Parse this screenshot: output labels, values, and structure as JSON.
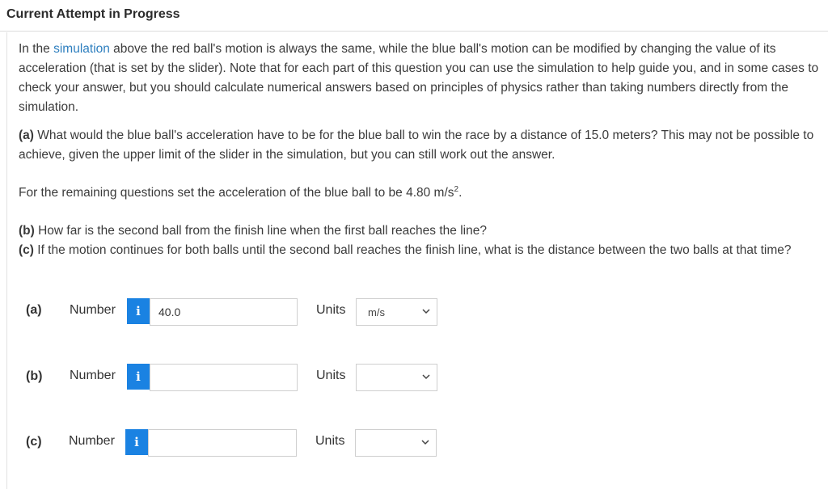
{
  "header": {
    "title": "Current Attempt in Progress"
  },
  "intro": {
    "before_link": "In the ",
    "link": "simulation",
    "after_link": " above the red ball's motion is always the same, while the blue ball's motion can be modified by changing the value of its acceleration (that is set by the slider). Note that for each part of this question you can use the simulation to help guide you, and in some cases to check your answer, but you should calculate numerical answers based on principles of physics rather than taking numbers directly from the simulation."
  },
  "part_a": {
    "tag": "(a)",
    "text": " What would the blue ball's acceleration have to be for the blue ball to win the race by a distance of 15.0 meters? This may not be possible to achieve, given the upper limit of the slider in the simulation, but you can still work out the answer."
  },
  "remaining": {
    "text": "For the remaining questions set the acceleration of the blue ball to be 4.80 m/s",
    "sup": "2",
    "end": "."
  },
  "part_b": {
    "tag": "(b)",
    "text": " How far is the second ball from the finish line when the first ball reaches the line?"
  },
  "part_c": {
    "tag": "(c)",
    "text": " If the motion continues for both balls until the second ball reaches the finish line, what is the distance between the two balls at that time?"
  },
  "answers": {
    "number_label": "Number",
    "units_label": "Units",
    "info_glyph": "i",
    "rows": [
      {
        "label": "(a)",
        "value": "40.0",
        "unit": "m/s"
      },
      {
        "label": "(b)",
        "value": "",
        "unit": ""
      },
      {
        "label": "(c)",
        "value": "",
        "unit": ""
      }
    ]
  },
  "icons": {
    "info": "info-icon",
    "dropdown": "chevron-down-icon"
  },
  "colors": {
    "link": "#2e7fbf",
    "info_badge": "#1a82e2"
  }
}
